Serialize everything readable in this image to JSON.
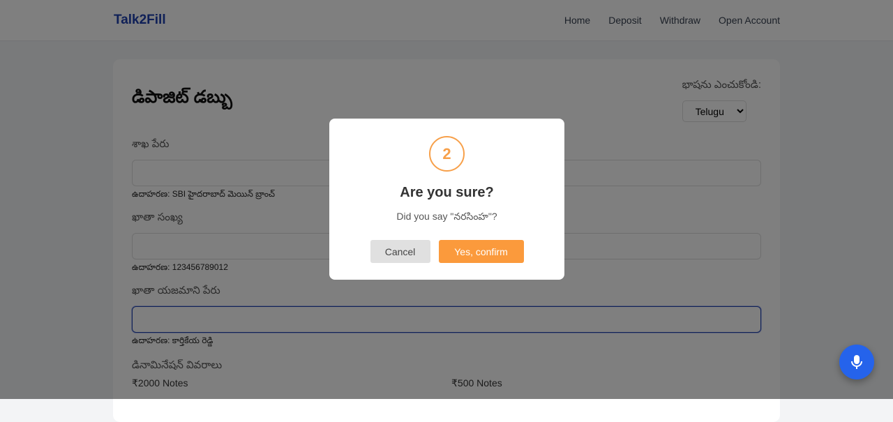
{
  "nav": {
    "logo": "Talk2Fill",
    "links": [
      "Home",
      "Deposit",
      "Withdraw",
      "Open Account"
    ]
  },
  "form": {
    "title": "డిపాజిట్ డబ్బు",
    "language_label": "భాషను ఎంచుకోండి:",
    "language_selected": "Telugu",
    "fields": [
      {
        "label": "శాఖ పేరు",
        "value": "",
        "hint": "ఉదాహరణ: SBI హైదరాబాద్ మెయిన్ బ్రాంచ్"
      },
      {
        "label": "ఖాతా సంఖ్య",
        "value": "",
        "hint": "ఉదాహరణ: 123456789012"
      },
      {
        "label": "ఖాతా యజమాని పేరు",
        "value": "",
        "hint": "ఉదాహరణ: కార్తికేయ రెడ్డి"
      }
    ],
    "denomination_label": "డినామినేషన్ వివరాలు",
    "notes": [
      "₹2000 Notes",
      "₹500 Notes"
    ]
  },
  "modal": {
    "step": "2",
    "title": "Are you sure?",
    "message": "Did you say \"నరసింహ\"?",
    "cancel": "Cancel",
    "confirm": "Yes, confirm"
  },
  "colors": {
    "brand": "#1e40af",
    "accent": "#fb9a3c",
    "mic": "#2563eb"
  },
  "icons": {
    "mic": "microphone-icon",
    "select": "chevron-down-icon"
  }
}
